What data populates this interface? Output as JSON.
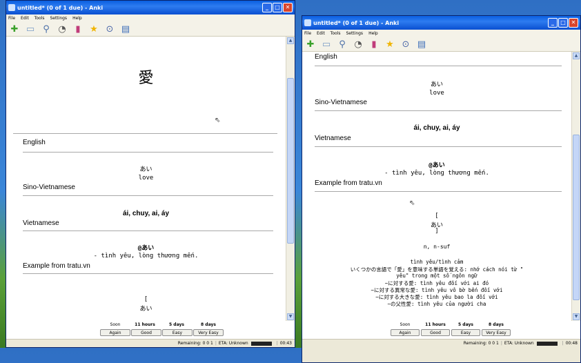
{
  "left_window": {
    "title": "untitled* (0 of 1 due) - Anki",
    "menus": [
      "File",
      "Edit",
      "Tools",
      "Settings",
      "Help"
    ],
    "toolbar_icons": [
      "add-icon",
      "cards-icon",
      "search-icon",
      "timer-icon",
      "graph-icon",
      "star-icon",
      "play-icon",
      "list-icon"
    ],
    "question": "愛",
    "english_label": "English",
    "reading": "あい",
    "meaning": "love",
    "sino_label": "Sino-Vietnamese",
    "sino_value": "ái, chuy, ai, áy",
    "vietnamese_label": "Vietnamese",
    "viet_kana": "@あい",
    "viet_line": "- tình yêu, lòng thương mến.",
    "example_label": "Example from tratu.vn",
    "bracket_open": "[",
    "bracket_kana": "あい",
    "answer": {
      "intervals": [
        "Soon",
        "11 hours",
        "5 days",
        "8 days"
      ],
      "buttons": [
        "Again",
        "Good",
        "Easy",
        "Very Easy"
      ]
    },
    "status": {
      "remaining": "Remaining: 0 0 1",
      "eta": "ETA: Unknown",
      "time": "00:43"
    }
  },
  "right_window": {
    "title": "untitled* (0 of 1 due) - Anki",
    "menus": [
      "File",
      "Edit",
      "Tools",
      "Settings",
      "Help"
    ],
    "english_label": "English",
    "reading": "あい",
    "meaning": "love",
    "sino_label": "Sino-Vietnamese",
    "sino_value": "ái, chuy, ai, áy",
    "vietnamese_label": "Vietnamese",
    "viet_kana": "@あい",
    "viet_line": "- tình yêu, lòng thương mến.",
    "example_label": "Example from tratu.vn",
    "bracket_open": "[",
    "bracket_kana": "あい",
    "bracket_close": "]",
    "pos": "n, n-suf",
    "example_lines": [
      "tình yêu/tình cảm",
      "いくつかの言語で「愛」を意味する単語を覚える: nhớ cách nói từ \"",
      "yêu\" trong một số ngôn ngữ",
      "~に対する愛: tình yêu đối với ai đó",
      "~に対する異常な愛: tình yêu vô bờ bến đối với",
      "~に対する大きな愛: tình yêu bao la đối với",
      "~の父性愛: tình yêu của người cha"
    ],
    "answer": {
      "intervals": [
        "Soon",
        "11 hours",
        "5 days",
        "8 days"
      ],
      "buttons": [
        "Again",
        "Good",
        "Easy",
        "Very Easy"
      ]
    },
    "status": {
      "remaining": "Remaining: 0 0 1",
      "eta": "ETA: Unknown",
      "time": "00:48"
    }
  }
}
